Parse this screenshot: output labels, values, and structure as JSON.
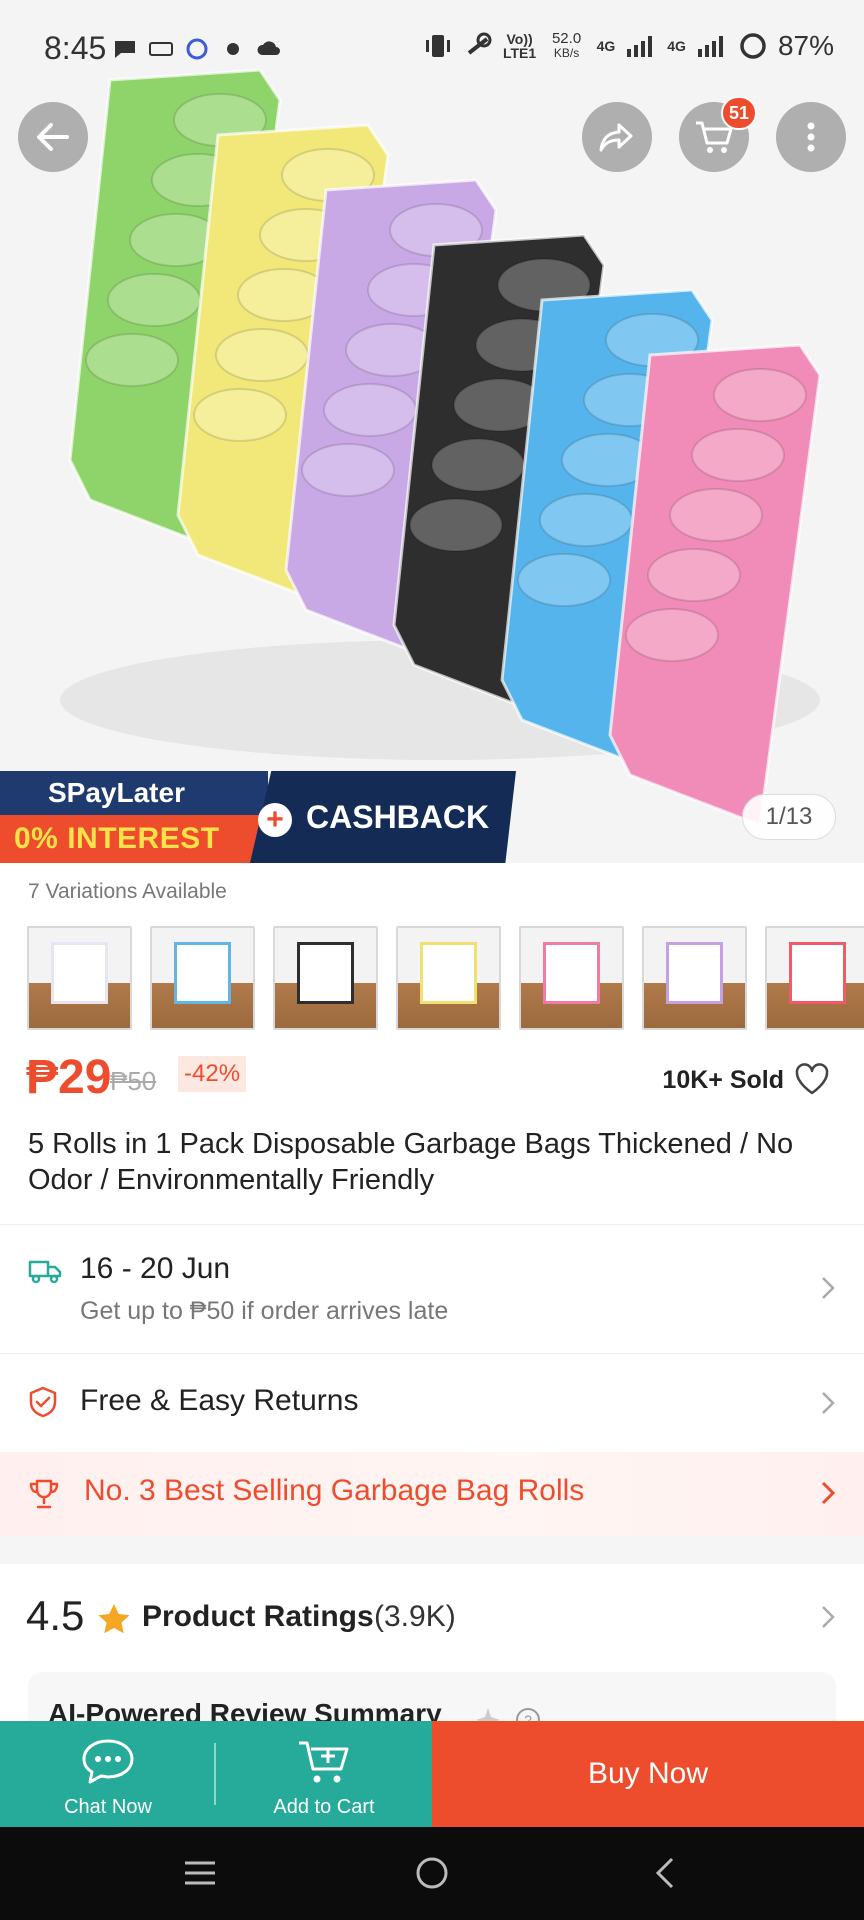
{
  "status_bar": {
    "time": "8:45",
    "volte": "Vo)) LTE1",
    "speed_value": "52.0",
    "speed_unit": "KB/s",
    "net1": "4G",
    "net2": "4G",
    "battery": "87%"
  },
  "header": {
    "back_icon": "arrow-left-icon",
    "share_icon": "share-icon",
    "cart_icon": "cart-icon",
    "cart_badge": "51",
    "more_icon": "more-vertical-icon"
  },
  "hero": {
    "image_counter": "1/13",
    "promo": {
      "spaylater": "SPayLater",
      "interest": "0% INTEREST",
      "cashback": "CASHBACK"
    },
    "roll_colors": [
      "#8fd46a",
      "#f2e87a",
      "#c9a8e6",
      "#2e2e2e",
      "#56b4ec",
      "#f08cb7"
    ]
  },
  "variations": {
    "label": "7 Variations Available",
    "thumb_colors": [
      "#e8e4f2",
      "#5fb6e8",
      "#2e2e2e",
      "#f0e070",
      "#f07aa8",
      "#c4a2e2",
      "#f25a6a"
    ]
  },
  "price": {
    "current": "₱29",
    "original": "₱50",
    "discount": "-42%",
    "sold": "10K+ Sold"
  },
  "product_title": "5 Rolls in 1 Pack Disposable Garbage Bags Thickened / No Odor / Environmentally Friendly",
  "shipping": {
    "dates": "16 - 20 Jun",
    "late_note": "Get up to ₱50 if order arrives late"
  },
  "returns": {
    "label": "Free & Easy Returns"
  },
  "best_selling": {
    "label": "No. 3 Best Selling Garbage Bag Rolls"
  },
  "ratings": {
    "score": "4.5",
    "label": "Product Ratings",
    "count": "(3.9K)"
  },
  "ai_summary": {
    "title": "AI-Powered Review Summary"
  },
  "bottom_bar": {
    "chat_label": "Chat Now",
    "cart_label": "Add to Cart",
    "buy_label": "Buy Now"
  },
  "colors": {
    "brand_orange": "#ee4d2d",
    "teal": "#26aa99"
  }
}
